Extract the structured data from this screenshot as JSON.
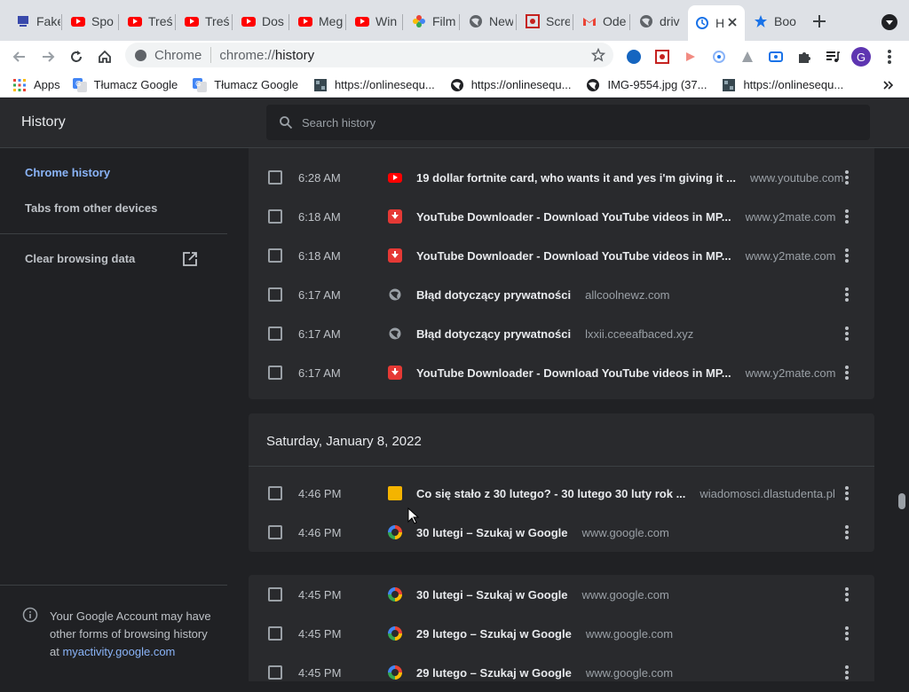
{
  "tabs": [
    {
      "title": "Fake",
      "icon": "fake-icon"
    },
    {
      "title": "Spo",
      "icon": "youtube-icon"
    },
    {
      "title": "Treś",
      "icon": "youtube-icon"
    },
    {
      "title": "Treś",
      "icon": "youtube-icon"
    },
    {
      "title": "Dos",
      "icon": "youtube-icon"
    },
    {
      "title": "Meg",
      "icon": "youtube-icon"
    },
    {
      "title": "Win",
      "icon": "youtube-icon"
    },
    {
      "title": "Film",
      "icon": "photos-icon"
    },
    {
      "title": "New",
      "icon": "globe-icon"
    },
    {
      "title": "Scre",
      "icon": "screencast-icon"
    },
    {
      "title": "Ode",
      "icon": "gmail-icon"
    },
    {
      "title": "driv",
      "icon": "globe-icon"
    },
    {
      "title": "H",
      "icon": "history-icon"
    },
    {
      "title": "Boo",
      "icon": "star-icon"
    }
  ],
  "omnibox": {
    "chip": "Chrome",
    "url_prefix": "chrome://",
    "url_path": "history"
  },
  "bookmarks": [
    {
      "label": "Apps"
    },
    {
      "label": "Tłumacz Google"
    },
    {
      "label": "Tłumacz Google"
    },
    {
      "label": "https://onlinesequ..."
    },
    {
      "label": "https://onlinesequ..."
    },
    {
      "label": "IMG-9554.jpg (37..."
    },
    {
      "label": "https://onlinesequ..."
    }
  ],
  "header": {
    "title": "History",
    "search_placeholder": "Search history"
  },
  "sidebar": {
    "chrome_history": "Chrome history",
    "tabs_other_devices": "Tabs from other devices",
    "clear_browsing_data": "Clear browsing data",
    "footer_text_1": "Your Google Account may have",
    "footer_text_2": "other forms of browsing history",
    "footer_text_3": "at",
    "footer_link": "myactivity.google.com"
  },
  "group1": {
    "rows": [
      {
        "time": "6:28 AM",
        "icon": "youtube-icon",
        "title": "19 dollar fortnite card, who wants it and yes i'm giving it ...",
        "domain": "www.youtube.com"
      },
      {
        "time": "6:18 AM",
        "icon": "download-icon",
        "title": "YouTube Downloader - Download YouTube videos in MP...",
        "domain": "www.y2mate.com"
      },
      {
        "time": "6:18 AM",
        "icon": "download-icon",
        "title": "YouTube Downloader - Download YouTube videos in MP...",
        "domain": "www.y2mate.com"
      },
      {
        "time": "6:17 AM",
        "icon": "globe-icon",
        "title": "Błąd dotyczący prywatności",
        "domain": "allcoolnewz.com"
      },
      {
        "time": "6:17 AM",
        "icon": "globe-icon",
        "title": "Błąd dotyczący prywatności",
        "domain": "lxxii.cceeafbaced.xyz"
      },
      {
        "time": "6:17 AM",
        "icon": "download-icon",
        "title": "YouTube Downloader - Download YouTube videos in MP...",
        "domain": "www.y2mate.com"
      }
    ]
  },
  "group2": {
    "date": "Saturday, January 8, 2022",
    "rows": [
      {
        "time": "4:46 PM",
        "icon": "dlastudenta-icon",
        "title": "Co się stało z 30 lutego? - 30 lutego 30 luty rok ...",
        "domain": "wiadomosci.dlastudenta.pl"
      },
      {
        "time": "4:46 PM",
        "icon": "google-icon",
        "title": "30 lutegi – Szukaj w Google",
        "domain": "www.google.com"
      }
    ]
  },
  "group3": {
    "rows": [
      {
        "time": "4:45 PM",
        "icon": "google-icon",
        "title": "30 lutegi – Szukaj w Google",
        "domain": "www.google.com"
      },
      {
        "time": "4:45 PM",
        "icon": "google-icon",
        "title": "29 lutego – Szukaj w Google",
        "domain": "www.google.com"
      },
      {
        "time": "4:45 PM",
        "icon": "google-icon",
        "title": "29 lutego – Szukaj w Google",
        "domain": "www.google.com"
      }
    ]
  }
}
